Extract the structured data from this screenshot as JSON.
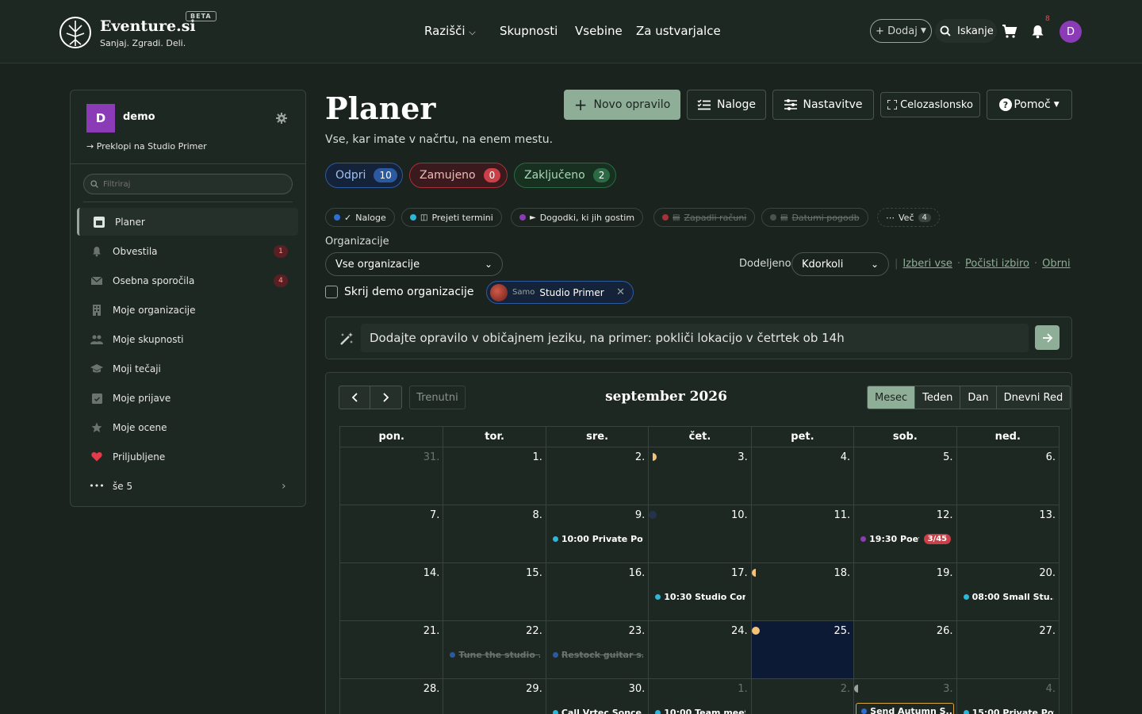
{
  "header": {
    "brand": "Eventure.si",
    "tagline": "Sanjaj. Zgradi. Deli.",
    "beta": "BETA",
    "nav": [
      "Razišči",
      "Skupnosti",
      "Vsebine",
      "Za ustvarjalce"
    ],
    "add_label": "+ Dodaj",
    "search_label": "Iskanje",
    "notification_count": "8",
    "user_initial": "D"
  },
  "sidebar": {
    "org_initial": "D",
    "org_name": "demo",
    "switch_label": "Preklopi na Studio Primer",
    "filter_placeholder": "Filtriraj",
    "items": [
      {
        "label": "Planer",
        "icon": "calendar-icon",
        "count": ""
      },
      {
        "label": "Obvestila",
        "icon": "bell-icon",
        "count": "1"
      },
      {
        "label": "Osebna sporočila",
        "icon": "envelope-icon",
        "count": "4"
      },
      {
        "label": "Moje organizacije",
        "icon": "building-icon",
        "count": ""
      },
      {
        "label": "Moje skupnosti",
        "icon": "users-icon",
        "count": ""
      },
      {
        "label": "Moji tečaji",
        "icon": "graduation-cap-icon",
        "count": ""
      },
      {
        "label": "Moje prijave",
        "icon": "calendar-check-icon",
        "count": ""
      },
      {
        "label": "Moje ocene",
        "icon": "star-icon",
        "count": ""
      },
      {
        "label": "Priljubljene",
        "icon": "heart-icon",
        "count": ""
      },
      {
        "label": "še 5",
        "icon": "more-icon",
        "count": ""
      }
    ]
  },
  "main": {
    "title": "Planer",
    "subtitle": "Vse, kar imate v načrtu, na enem mestu.",
    "buttons": {
      "new_task": "Novo opravilo",
      "tasks": "Naloge",
      "settings": "Nastavitve",
      "fullscreen": "Celozaslonsko",
      "help": "Pomoč"
    },
    "status": [
      {
        "label": "Odpri",
        "count": "10"
      },
      {
        "label": "Zamujeno",
        "count": "0"
      },
      {
        "label": "Zaključeno",
        "count": "2"
      }
    ],
    "chips": [
      {
        "label": "Naloge",
        "color": "#2c6ed5"
      },
      {
        "label": "Prejeti termini",
        "color": "#2cb6d8"
      },
      {
        "label": "Dogodki, ki jih gostim",
        "color": "#8a3bb5"
      },
      {
        "label": "Zapadli računi",
        "color": "#a83038"
      },
      {
        "label": "Datumi pogodb",
        "color": "#4a544e"
      },
      {
        "label": "Več",
        "count": "4"
      }
    ],
    "orgs_label": "Organizacije",
    "orgs_select": "Vse organizacije",
    "assigned_label": "Dodeljeno",
    "assigned_select": "Kdorkoli",
    "links": [
      "Izberi vse",
      "Počisti izbiro",
      "Obrni"
    ],
    "hide_demo_label": "Skrij demo organizacije",
    "org_chip_prefix": "Samo",
    "org_chip_name": "Studio Primer",
    "nl_placeholder": "Dodajte opravilo v običajnem jeziku, na primer: pokliči lokacijo v četrtek ob 14h"
  },
  "calendar": {
    "today_label": "Trenutni",
    "title": "september 2026",
    "views": [
      "Mesec",
      "Teden",
      "Dan",
      "Dnevni Red"
    ],
    "active_view": "Mesec",
    "weekdays": [
      "pon.",
      "tor.",
      "sre.",
      "čet.",
      "pet.",
      "sob.",
      "ned."
    ],
    "weeks": [
      [
        {
          "n": "31.",
          "other": true
        },
        {
          "n": "1."
        },
        {
          "n": "2."
        },
        {
          "n": "3.",
          "moon": "first"
        },
        {
          "n": "4."
        },
        {
          "n": "5."
        },
        {
          "n": "6."
        }
      ],
      [
        {
          "n": "7."
        },
        {
          "n": "8."
        },
        {
          "n": "9.",
          "event": "10:00 Private Pot...",
          "color": "#2cb6d8"
        },
        {
          "n": "10.",
          "moon": "new"
        },
        {
          "n": "11."
        },
        {
          "n": "12.",
          "event": "19:30 Poet...",
          "color": "#8a3bb5",
          "badge": "3/45"
        },
        {
          "n": "13."
        }
      ],
      [
        {
          "n": "14."
        },
        {
          "n": "15."
        },
        {
          "n": "16."
        },
        {
          "n": "17.",
          "event": "10:30 Studio Con...",
          "color": "#2cb6d8"
        },
        {
          "n": "18.",
          "moon": "quarter"
        },
        {
          "n": "19."
        },
        {
          "n": "20.",
          "event": "08:00 Small Stu...",
          "color": "#2cb6d8"
        }
      ],
      [
        {
          "n": "21."
        },
        {
          "n": "22.",
          "event": "Tune the studio ...",
          "color": "#2c5aa0",
          "done": true
        },
        {
          "n": "23.",
          "event": "Restock guitar s...",
          "color": "#2c5aa0",
          "done": true
        },
        {
          "n": "24."
        },
        {
          "n": "25.",
          "today": true,
          "moon": "full"
        },
        {
          "n": "26."
        },
        {
          "n": "27."
        }
      ],
      [
        {
          "n": "28."
        },
        {
          "n": "29."
        },
        {
          "n": "30.",
          "event": "Call Vrtec Sonce...",
          "color": "#2cb6d8"
        },
        {
          "n": "1.",
          "other": true,
          "event": "10:00 Team meet...",
          "color": "#2cb6d8"
        },
        {
          "n": "2.",
          "other": true
        },
        {
          "n": "3.",
          "other": true,
          "moon": "last",
          "event": "Send Autumn S...",
          "color": "#2c6ed5",
          "box": true
        },
        {
          "n": "4.",
          "other": true,
          "event": "15:00 Private Pot...",
          "color": "#2cb6d8"
        }
      ]
    ]
  }
}
